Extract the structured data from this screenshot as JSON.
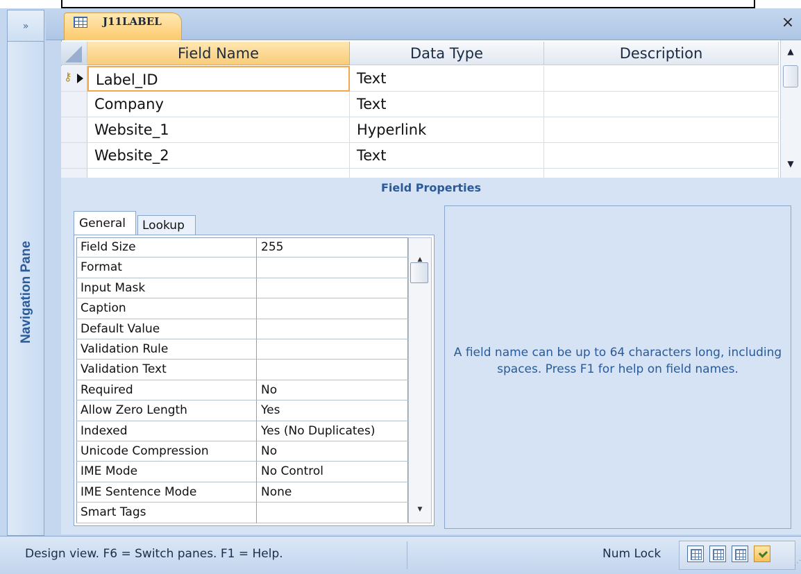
{
  "navigation": {
    "toggle_glyph": "»",
    "pane_label": "Navigation Pane"
  },
  "document_tab": {
    "title": "J11LABEL",
    "close_glyph": "×"
  },
  "design_grid": {
    "columns": [
      "Field Name",
      "Data Type",
      "Description"
    ],
    "rows": [
      {
        "field_name": "Label_ID",
        "data_type": "Text",
        "description": "",
        "primary_key": true,
        "current": true
      },
      {
        "field_name": "Company",
        "data_type": "Text",
        "description": ""
      },
      {
        "field_name": "Website_1",
        "data_type": "Hyperlink",
        "description": ""
      },
      {
        "field_name": "Website_2",
        "data_type": "Text",
        "description": ""
      }
    ]
  },
  "field_properties": {
    "title": "Field Properties",
    "tabs": [
      "General",
      "Lookup"
    ],
    "active_tab": "General",
    "properties": [
      {
        "name": "Field Size",
        "value": "255"
      },
      {
        "name": "Format",
        "value": ""
      },
      {
        "name": "Input Mask",
        "value": ""
      },
      {
        "name": "Caption",
        "value": ""
      },
      {
        "name": "Default Value",
        "value": ""
      },
      {
        "name": "Validation Rule",
        "value": ""
      },
      {
        "name": "Validation Text",
        "value": ""
      },
      {
        "name": "Required",
        "value": "No"
      },
      {
        "name": "Allow Zero Length",
        "value": "Yes"
      },
      {
        "name": "Indexed",
        "value": "Yes (No Duplicates)"
      },
      {
        "name": "Unicode Compression",
        "value": "No"
      },
      {
        "name": "IME Mode",
        "value": "No Control"
      },
      {
        "name": "IME Sentence Mode",
        "value": "None"
      },
      {
        "name": "Smart Tags",
        "value": ""
      }
    ],
    "help_text": "A field name can be up to 64 characters long, including spaces.  Press F1 for help on field names."
  },
  "status_bar": {
    "message": "Design view.  F6 = Switch panes.  F1 = Help.",
    "num_lock": "Num Lock",
    "view_buttons": [
      "datasheet-view-icon",
      "pivottable-view-icon",
      "pivotchart-view-icon",
      "design-view-icon"
    ],
    "active_view": "design-view-icon"
  },
  "colors": {
    "accent_tab": "#fcc868",
    "frame": "#c5d7ee",
    "label_blue": "#2a5a99"
  }
}
